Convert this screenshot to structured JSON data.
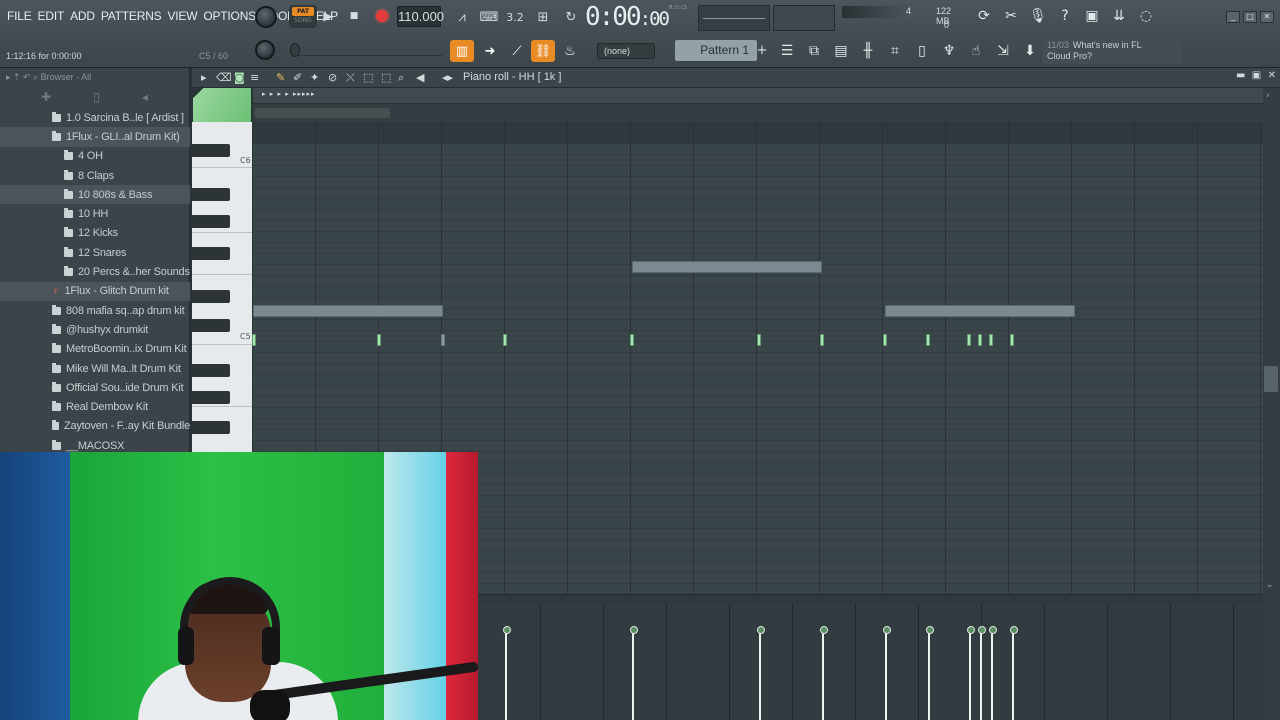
{
  "menu": [
    "FILE",
    "EDIT",
    "ADD",
    "PATTERNS",
    "VIEW",
    "OPTIONS",
    "TOOLS",
    "HELP"
  ],
  "transport": {
    "pat_label": "PAT",
    "song_label": "SONG",
    "tempo": "110.000"
  },
  "time_display": {
    "main": "0:00",
    "sub": ":00",
    "unit_label": "M:S:CS"
  },
  "status": {
    "cpu": "4",
    "ram": "122 MB",
    "polyphony": "0"
  },
  "hint_bar": {
    "time": "1:12:16 for 0:00:00",
    "note": "C5 / 60"
  },
  "snap": {
    "value": "(none)"
  },
  "pattern": {
    "name": "Pattern 1",
    "add_symbol": "+"
  },
  "news": {
    "date": "11/03",
    "text_line1": "What's new in FL",
    "text_line2": "Cloud Pro?"
  },
  "browser": {
    "header": "Browser - All",
    "items": [
      {
        "label": "1.0 Sarcina B..le [ Ardist ]",
        "indent": 1,
        "selected": false,
        "pinned": false
      },
      {
        "label": "1Flux - GLI..al Drum Kit)",
        "indent": 1,
        "selected": true,
        "pinned": false
      },
      {
        "label": "4 OH",
        "indent": 2,
        "selected": false,
        "pinned": false
      },
      {
        "label": "8 Claps",
        "indent": 2,
        "selected": false,
        "pinned": false
      },
      {
        "label": "10 808s & Bass",
        "indent": 2,
        "selected": true,
        "pinned": false
      },
      {
        "label": "10 HH",
        "indent": 2,
        "selected": false,
        "pinned": false
      },
      {
        "label": "12 Kicks",
        "indent": 2,
        "selected": false,
        "pinned": false
      },
      {
        "label": "12 Snares",
        "indent": 2,
        "selected": false,
        "pinned": false
      },
      {
        "label": "20 Percs &..her Sounds",
        "indent": 2,
        "selected": false,
        "pinned": false
      },
      {
        "label": "1Flux - Glitch Drum kit",
        "indent": 1,
        "selected": true,
        "pinned": true
      },
      {
        "label": "808 mafia sq..ap drum kit",
        "indent": 1,
        "selected": false,
        "pinned": false
      },
      {
        "label": "@hushyx drumkit",
        "indent": 1,
        "selected": false,
        "pinned": false
      },
      {
        "label": "MetroBoomin..ix Drum Kit",
        "indent": 1,
        "selected": false,
        "pinned": false
      },
      {
        "label": "Mike Will Ma..lt Drum Kit",
        "indent": 1,
        "selected": false,
        "pinned": false
      },
      {
        "label": "Official Sou..ide Drum Kit",
        "indent": 1,
        "selected": false,
        "pinned": false
      },
      {
        "label": "Real Dembow Kit",
        "indent": 1,
        "selected": false,
        "pinned": false
      },
      {
        "label": "Zaytoven - F..ay Kit Bundle",
        "indent": 1,
        "selected": false,
        "pinned": false
      },
      {
        "label": "__MACOSX",
        "indent": 1,
        "selected": false,
        "pinned": false
      }
    ]
  },
  "piano_roll": {
    "title": "Piano roll - HH [ 1k ]",
    "octave_labels": {
      "c6": "C6",
      "c5": "C5"
    }
  },
  "colors": {
    "accent_orange": "#e98b24",
    "note_green": "#a9e4b2",
    "record_red": "#e33b3b",
    "grid_bg": "#3a4549"
  },
  "icons": {
    "play": "play-icon",
    "stop": "stop-icon",
    "record": "record-icon",
    "metronome": "metronome-icon",
    "step": "typing-keyboard-icon"
  }
}
